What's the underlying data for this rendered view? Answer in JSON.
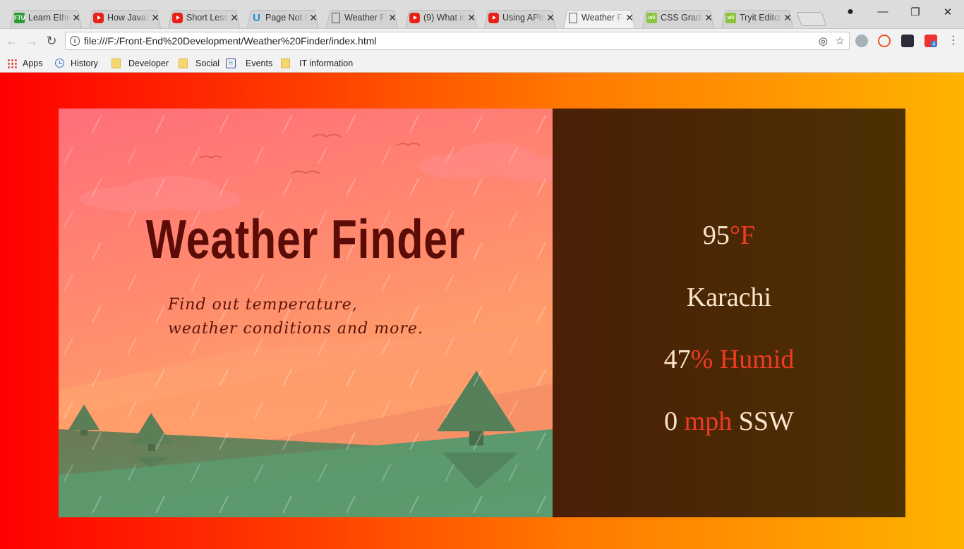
{
  "browser": {
    "tabs": [
      {
        "title": "Learn Ethical Hacking",
        "favicon": "ftu-icon"
      },
      {
        "title": "How JavaScript",
        "favicon": "youtube-icon"
      },
      {
        "title": "Short Lessons",
        "favicon": "youtube-icon"
      },
      {
        "title": "Page Not Found",
        "favicon": "udemy-icon"
      },
      {
        "title": "Weather Finder",
        "favicon": "document-icon"
      },
      {
        "title": "(9) What is",
        "favicon": "youtube-icon"
      },
      {
        "title": "Using APIs",
        "favicon": "youtube-icon"
      },
      {
        "title": "Weather Finder",
        "favicon": "document-icon",
        "active": true
      },
      {
        "title": "CSS Gradients",
        "favicon": "w3schools-icon"
      },
      {
        "title": "Tryit Editor",
        "favicon": "w3schools-icon"
      }
    ],
    "url": "file:///F:/Front-End%20Development/Weather%20Finder/index.html",
    "bookmarks": [
      "Apps",
      "History",
      "Developer",
      "Social",
      "Events",
      "IT information"
    ],
    "extension_badge": "4"
  },
  "app": {
    "title": "Weather Finder",
    "subtitle_line1": "Find out temperature,",
    "subtitle_line2": "weather conditions and more.",
    "temperature_value": "95",
    "temperature_unit": "°F",
    "city": "Karachi",
    "humidity_value": "47",
    "humidity_unit": "% Humid",
    "wind_speed": "0",
    "wind_unit": "mph",
    "wind_direction": "SSW"
  },
  "colors": {
    "page_gradient_start": "#ff0000",
    "page_gradient_end": "#ffb300",
    "panel_bg": "#4a2a05",
    "accent_red": "#ef3a24",
    "title_color": "#5b0c06",
    "value_color": "#fbe6cd"
  }
}
